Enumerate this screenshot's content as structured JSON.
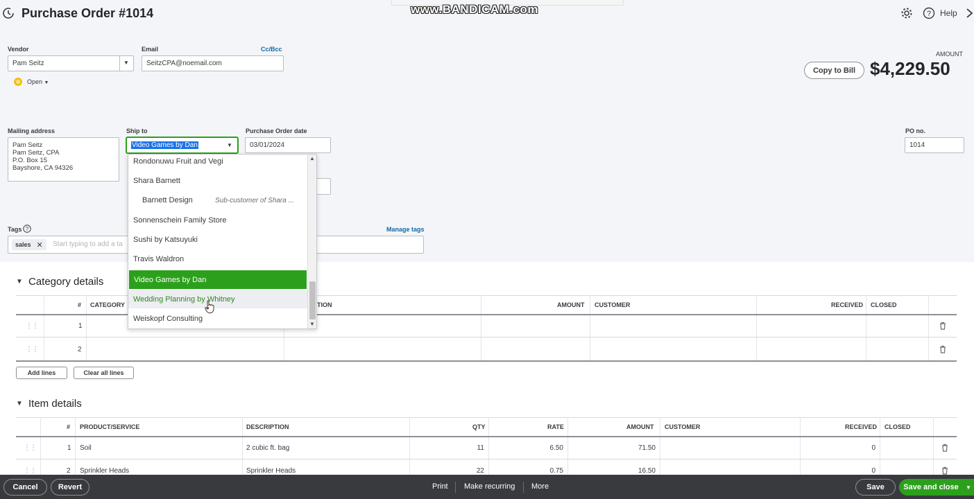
{
  "header": {
    "title": "Purchase Order #1014",
    "help_label": "Help",
    "watermark": "www.BANDICAM.com"
  },
  "vendor": {
    "label": "Vendor",
    "value": "Pam Seitz",
    "status": "Open"
  },
  "email": {
    "label": "Email",
    "value": "SeitzCPA@noemail.com",
    "cc_bcc": "Cc/Bcc"
  },
  "amount": {
    "label": "AMOUNT",
    "value": "$4,229.50",
    "copy_to_bill": "Copy to Bill"
  },
  "mailing": {
    "label": "Mailing address",
    "lines": [
      "Pam Seitz",
      "Pam Seitz, CPA",
      "P.O. Box 15",
      "Bayshore, CA  94326"
    ]
  },
  "ship_to": {
    "label": "Ship to",
    "value": "Video Games by Dan",
    "options": [
      {
        "label": "Rondonuwu Fruit and Vegi"
      },
      {
        "label": "Shara Barnett"
      },
      {
        "label": "Barnett Design",
        "note": "Sub-customer of Shara ..."
      },
      {
        "label": "Sonnenschein Family Store"
      },
      {
        "label": "Sushi by Katsuyuki"
      },
      {
        "label": "Travis Waldron"
      },
      {
        "label": "Video Games by Dan"
      },
      {
        "label": "Wedding Planning by Whitney"
      },
      {
        "label": "Weiskopf Consulting"
      }
    ]
  },
  "po_date": {
    "label": "Purchase Order date",
    "value": "03/01/2024"
  },
  "po_no": {
    "label": "PO no.",
    "value": "1014"
  },
  "tags": {
    "label": "Tags",
    "manage": "Manage tags",
    "chip": "sales",
    "placeholder": "Start typing to add a ta"
  },
  "category": {
    "title": "Category details",
    "columns": [
      "#",
      "CATEGORY",
      "TION",
      "AMOUNT",
      "CUSTOMER",
      "RECEIVED",
      "CLOSED"
    ],
    "rows": [
      {
        "num": "1"
      },
      {
        "num": "2"
      }
    ],
    "add_lines": "Add lines",
    "clear_lines": "Clear all lines"
  },
  "items": {
    "title": "Item details",
    "columns": [
      "#",
      "PRODUCT/SERVICE",
      "DESCRIPTION",
      "QTY",
      "RATE",
      "AMOUNT",
      "CUSTOMER",
      "RECEIVED",
      "CLOSED"
    ],
    "rows": [
      {
        "num": "1",
        "product": "Soil",
        "description": "2 cubic ft. bag",
        "qty": "11",
        "rate": "6.50",
        "amount": "71.50",
        "received": "0"
      },
      {
        "num": "2",
        "product": "Sprinkler Heads",
        "description": "Sprinkler Heads",
        "qty": "22",
        "rate": "0.75",
        "amount": "16.50",
        "received": "0"
      }
    ]
  },
  "footer": {
    "cancel": "Cancel",
    "revert": "Revert",
    "print": "Print",
    "make_recurring": "Make recurring",
    "more": "More",
    "save": "Save",
    "save_and_close": "Save and close"
  },
  "colors": {
    "accent_green": "#2ca01c",
    "footer_bg": "#393a3d",
    "link_blue": "#0d6aa8"
  }
}
